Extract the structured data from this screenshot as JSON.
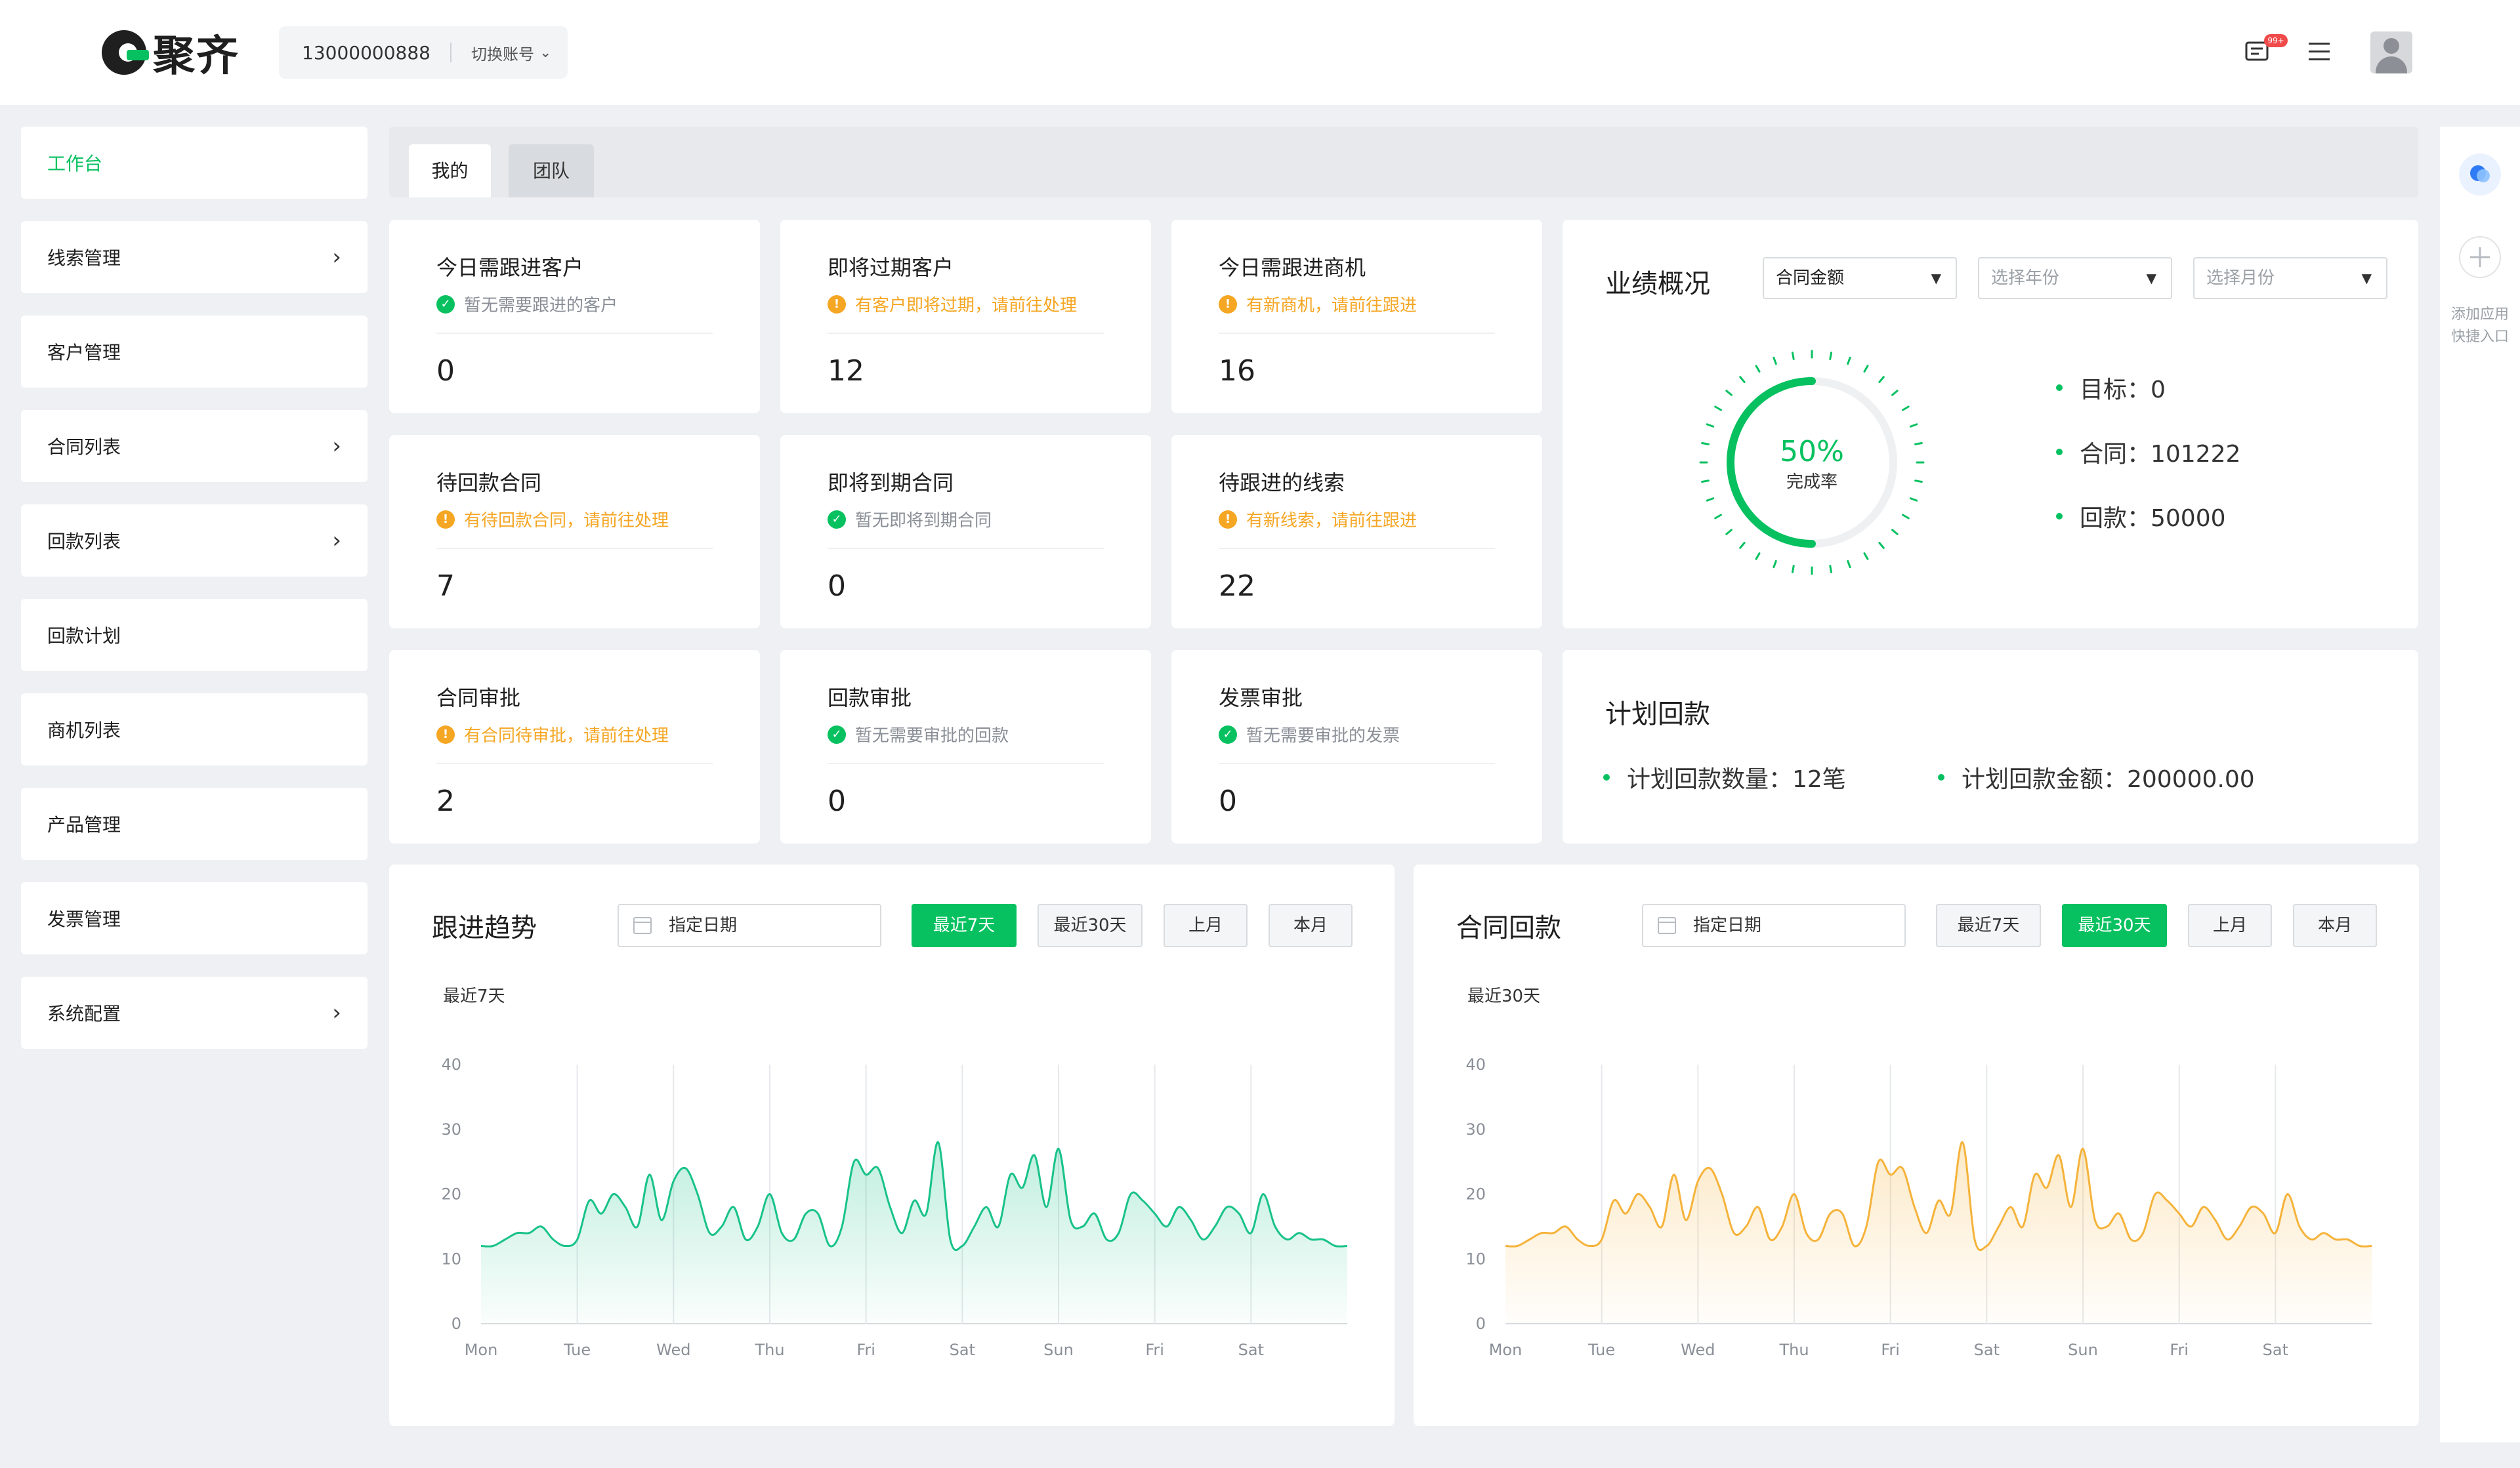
{
  "header": {
    "brand": "聚齐",
    "account_phone": "13000000888",
    "switch_label": "切换账号",
    "badge": "99+"
  },
  "sidebar": {
    "items": [
      {
        "label": "工作台",
        "active": true,
        "arrow": false
      },
      {
        "label": "线索管理",
        "arrow": true
      },
      {
        "label": "客户管理",
        "arrow": false
      },
      {
        "label": "合同列表",
        "arrow": true
      },
      {
        "label": "回款列表",
        "arrow": true
      },
      {
        "label": "回款计划",
        "arrow": false
      },
      {
        "label": "商机列表",
        "arrow": false
      },
      {
        "label": "产品管理",
        "arrow": false
      },
      {
        "label": "发票管理",
        "arrow": false
      },
      {
        "label": "系统配置",
        "arrow": true
      }
    ],
    "arrow_glyph": "›"
  },
  "tabs": [
    "我的",
    "团队"
  ],
  "stats": [
    {
      "title": "今日需跟进客户",
      "note": "暂无需要跟进的客户",
      "status": "ok",
      "value": "0"
    },
    {
      "title": "即将过期客户",
      "note": "有客户即将过期，请前往处理",
      "status": "warn",
      "value": "12"
    },
    {
      "title": "今日需跟进商机",
      "note": "有新商机，请前往跟进",
      "status": "warn",
      "value": "16"
    },
    {
      "title": "待回款合同",
      "note": "有待回款合同，请前往处理",
      "status": "warn",
      "value": "7"
    },
    {
      "title": "即将到期合同",
      "note": "暂无即将到期合同",
      "status": "ok",
      "value": "0"
    },
    {
      "title": "待跟进的线索",
      "note": "有新线索，请前往跟进",
      "status": "warn",
      "value": "22"
    },
    {
      "title": "合同审批",
      "note": "有合同待审批，请前往处理",
      "status": "warn",
      "value": "2"
    },
    {
      "title": "回款审批",
      "note": "暂无需要审批的回款",
      "status": "ok",
      "value": "0"
    },
    {
      "title": "发票审批",
      "note": "暂无需要审批的发票",
      "status": "ok",
      "value": "0"
    }
  ],
  "performance": {
    "title": "业绩概况",
    "select_amount": "合同金额",
    "select_year": "选择年份",
    "select_month": "选择月份",
    "completion": 0.5,
    "completion_text": "50%",
    "completion_label": "完成率",
    "target": "目标：0",
    "contract": "合同：101222",
    "payment": "回款：50000"
  },
  "plan": {
    "title": "计划回款",
    "count": "计划回款数量：12笔",
    "amount": "计划回款金额：200000.00"
  },
  "rail": {
    "add_label_1": "添加应用",
    "add_label_2": "快捷入口"
  },
  "colors": {
    "accent": "#07c160",
    "warn": "#f5a623",
    "follow_line": "#19c28a",
    "contract_line": "#f5b33b"
  },
  "filters": {
    "date_placeholder": "指定日期",
    "last7": "最近7天",
    "last30": "最近30天",
    "last_month": "上月",
    "this_month": "本月"
  },
  "chart_data": [
    {
      "type": "area",
      "title": "跟进趋势",
      "range_label": "最近7天",
      "active_filter": "最近7天",
      "categories": [
        "Mon",
        "Tue",
        "Wed",
        "Thu",
        "Fri",
        "Sat",
        "Sun",
        "Fri",
        "Sat"
      ],
      "ylim": [
        0,
        40
      ],
      "yticks": [
        0,
        10,
        20,
        30,
        40
      ],
      "grid": true,
      "values": [
        12,
        12,
        13,
        14,
        14,
        15,
        13,
        12,
        13,
        19,
        17,
        20,
        18,
        15,
        23,
        16,
        22,
        24,
        20,
        14,
        15,
        18,
        13,
        15,
        20,
        14,
        13,
        17,
        17,
        12,
        15,
        25,
        23,
        24,
        18,
        14,
        19,
        17,
        28,
        13,
        12,
        15,
        18,
        15,
        23,
        21,
        26,
        18,
        27,
        16,
        15,
        17,
        13,
        14,
        20,
        19,
        17,
        15,
        18,
        16,
        13,
        15,
        18,
        17,
        14,
        20,
        15,
        13,
        14,
        13,
        13,
        12,
        12
      ]
    },
    {
      "type": "area",
      "title": "合同回款",
      "range_label": "最近30天",
      "active_filter": "最近30天",
      "categories": [
        "Mon",
        "Tue",
        "Wed",
        "Thu",
        "Fri",
        "Sat",
        "Sun",
        "Fri",
        "Sat"
      ],
      "ylim": [
        0,
        40
      ],
      "yticks": [
        0,
        10,
        20,
        30,
        40
      ],
      "grid": true,
      "values": [
        12,
        12,
        13,
        14,
        14,
        15,
        13,
        12,
        13,
        19,
        17,
        20,
        18,
        15,
        23,
        16,
        22,
        24,
        20,
        14,
        15,
        18,
        13,
        15,
        20,
        14,
        13,
        17,
        17,
        12,
        15,
        25,
        23,
        24,
        18,
        14,
        19,
        17,
        28,
        13,
        12,
        15,
        18,
        15,
        23,
        21,
        26,
        18,
        27,
        16,
        15,
        17,
        13,
        14,
        20,
        19,
        17,
        15,
        18,
        16,
        13,
        15,
        18,
        17,
        14,
        20,
        15,
        13,
        14,
        13,
        13,
        12,
        12
      ]
    }
  ]
}
